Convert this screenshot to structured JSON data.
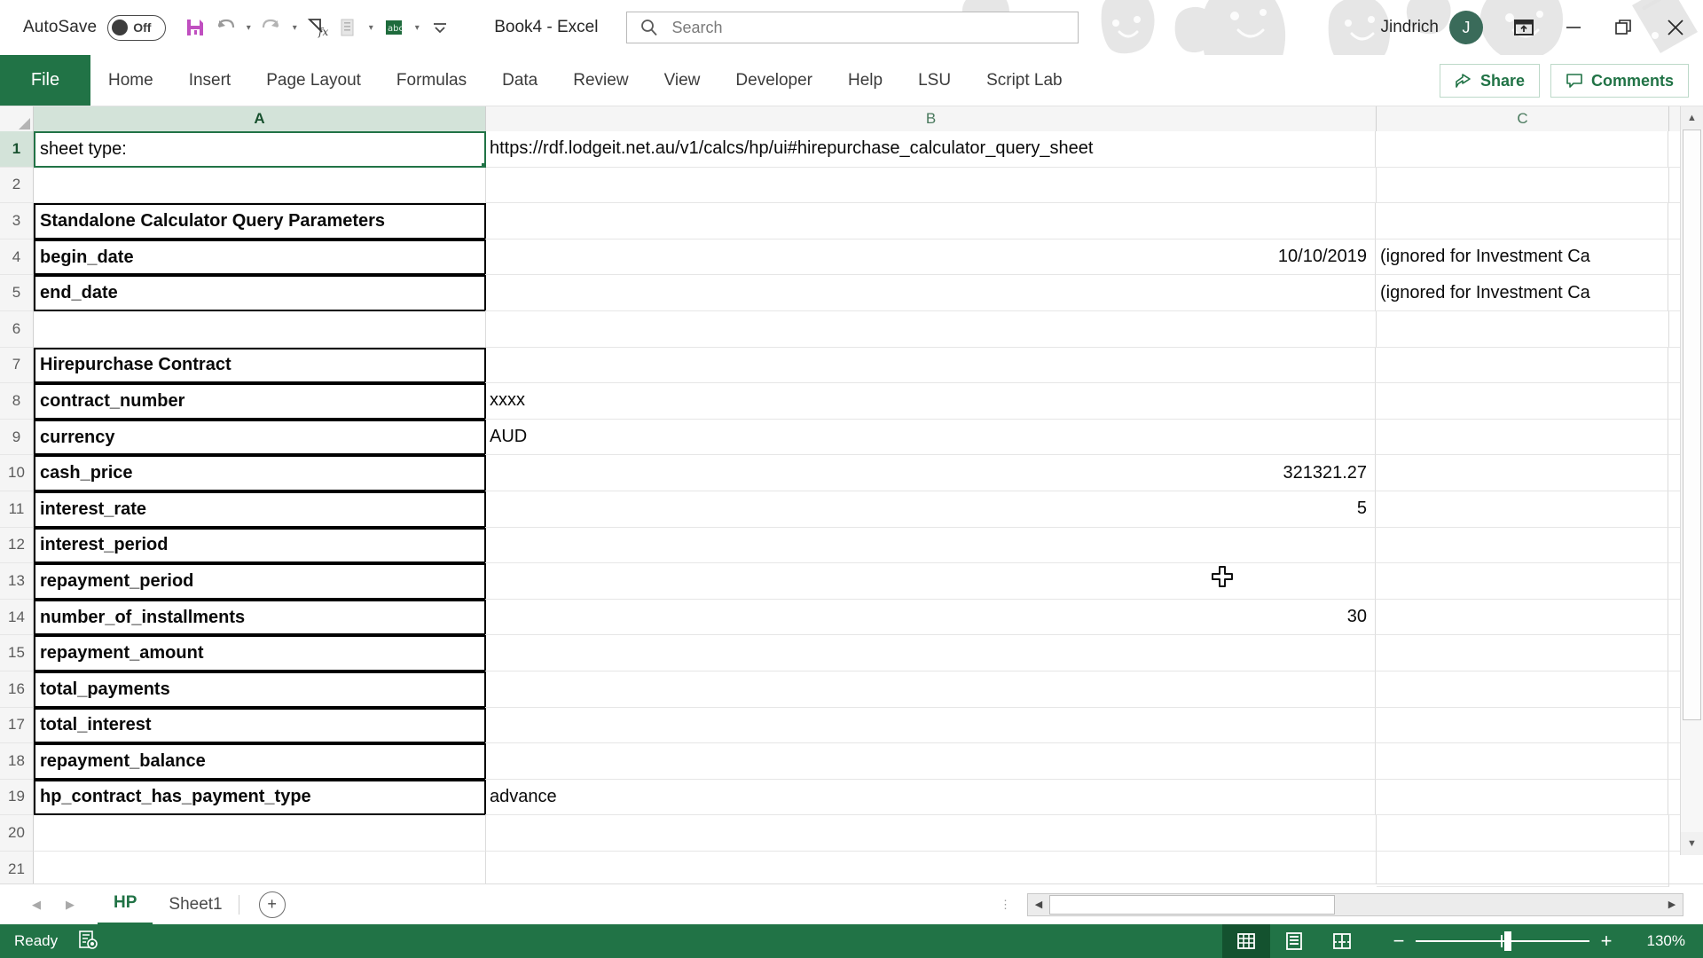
{
  "titlebar": {
    "autosave_label": "AutoSave",
    "autosave_state": "Off",
    "document_title": "Book4  -  Excel",
    "account_name": "Jindrich",
    "avatar_initial": "J",
    "quick_access": [
      {
        "name": "save-icon",
        "label": "Save"
      },
      {
        "name": "undo-icon",
        "label": "Undo"
      },
      {
        "name": "redo-icon",
        "label": "Redo"
      },
      {
        "name": "insert-function-icon",
        "label": "Insert Function"
      },
      {
        "name": "paste-icon",
        "label": "Paste"
      },
      {
        "name": "macro-icon",
        "label": "Macros"
      },
      {
        "name": "customize-quick-access-toolbar-icon",
        "label": "Customize Quick Access Toolbar"
      }
    ],
    "window_controls": [
      {
        "name": "ribbon-display-options-button",
        "label": "Ribbon Display Options"
      },
      {
        "name": "minimize-button",
        "label": "Minimize"
      },
      {
        "name": "restore-button",
        "label": "Restore Down"
      },
      {
        "name": "close-button",
        "label": "Close"
      }
    ]
  },
  "search": {
    "placeholder": "Search",
    "value": ""
  },
  "ribbon": {
    "file_tab": "File",
    "tabs": [
      {
        "label": "Home"
      },
      {
        "label": "Insert"
      },
      {
        "label": "Page Layout"
      },
      {
        "label": "Formulas"
      },
      {
        "label": "Data"
      },
      {
        "label": "Review"
      },
      {
        "label": "View"
      },
      {
        "label": "Developer"
      },
      {
        "label": "Help"
      },
      {
        "label": "LSU"
      },
      {
        "label": "Script Lab"
      }
    ],
    "share_label": "Share",
    "comments_label": "Comments"
  },
  "grid": {
    "columns": [
      "A",
      "B",
      "C"
    ],
    "selected_cell": "A1",
    "rows": [
      {
        "num": "1",
        "a": "sheet type:",
        "a_bold": false,
        "b": "https://rdf.lodgeit.net.au/v1/calcs/hp/ui#hirepurchase_calculator_query_sheet",
        "b_align": "left",
        "c": ""
      },
      {
        "num": "2",
        "a": "",
        "a_bold": false,
        "b": "",
        "b_align": "left",
        "c": ""
      },
      {
        "num": "3",
        "a": "Standalone Calculator Query Parameters",
        "a_bold": true,
        "b": "",
        "b_align": "left",
        "c": ""
      },
      {
        "num": "4",
        "a": "begin_date",
        "a_bold": true,
        "b": "10/10/2019",
        "b_align": "right",
        "c": "(ignored for Investment Ca"
      },
      {
        "num": "5",
        "a": "end_date",
        "a_bold": true,
        "b": "",
        "b_align": "right",
        "c": "(ignored for Investment Ca"
      },
      {
        "num": "6",
        "a": "",
        "a_bold": false,
        "b": "",
        "b_align": "left",
        "c": ""
      },
      {
        "num": "7",
        "a": "Hirepurchase Contract",
        "a_bold": true,
        "b": "",
        "b_align": "left",
        "c": ""
      },
      {
        "num": "8",
        "a": "contract_number",
        "a_bold": true,
        "b": "xxxx",
        "b_align": "left",
        "c": ""
      },
      {
        "num": "9",
        "a": "currency",
        "a_bold": true,
        "b": "AUD",
        "b_align": "left",
        "c": ""
      },
      {
        "num": "10",
        "a": "cash_price",
        "a_bold": true,
        "b": "321321.27",
        "b_align": "right",
        "c": ""
      },
      {
        "num": "11",
        "a": "interest_rate",
        "a_bold": true,
        "b": "5",
        "b_align": "right",
        "c": ""
      },
      {
        "num": "12",
        "a": "interest_period",
        "a_bold": true,
        "b": "",
        "b_align": "right",
        "c": ""
      },
      {
        "num": "13",
        "a": "repayment_period",
        "a_bold": true,
        "b": "",
        "b_align": "right",
        "c": ""
      },
      {
        "num": "14",
        "a": "number_of_installments",
        "a_bold": true,
        "b": "30",
        "b_align": "right",
        "c": ""
      },
      {
        "num": "15",
        "a": "repayment_amount",
        "a_bold": true,
        "b": "",
        "b_align": "right",
        "c": ""
      },
      {
        "num": "16",
        "a": "total_payments",
        "a_bold": true,
        "b": "",
        "b_align": "right",
        "c": ""
      },
      {
        "num": "17",
        "a": "total_interest",
        "a_bold": true,
        "b": "",
        "b_align": "right",
        "c": ""
      },
      {
        "num": "18",
        "a": "repayment_balance",
        "a_bold": true,
        "b": "",
        "b_align": "right",
        "c": ""
      },
      {
        "num": "19",
        "a": "hp_contract_has_payment_type",
        "a_bold": true,
        "b": "advance",
        "b_align": "left",
        "c": ""
      },
      {
        "num": "20",
        "a": "",
        "a_bold": false,
        "b": "",
        "b_align": "left",
        "c": ""
      },
      {
        "num": "21",
        "a": "",
        "a_bold": false,
        "b": "",
        "b_align": "left",
        "c": ""
      }
    ]
  },
  "sheet_tabs": {
    "tabs": [
      {
        "label": "HP",
        "active": true
      },
      {
        "label": "Sheet1",
        "active": false
      }
    ],
    "add_sheet_label": "+"
  },
  "statusbar": {
    "status_text": "Ready",
    "accessibility_icon": "accessibility-checker-icon",
    "views": [
      {
        "name": "normal-view-button",
        "label": "Normal",
        "active": true
      },
      {
        "name": "page-layout-view-button",
        "label": "Page Layout",
        "active": false
      },
      {
        "name": "page-break-preview-button",
        "label": "Page Break Preview",
        "active": false
      }
    ],
    "zoom_out_label": "−",
    "zoom_in_label": "+",
    "zoom_level": "130%"
  },
  "colors": {
    "excel_green": "#217346",
    "status_green": "#217346",
    "selection_green": "#217346",
    "header_gray": "#f5f5f5"
  }
}
